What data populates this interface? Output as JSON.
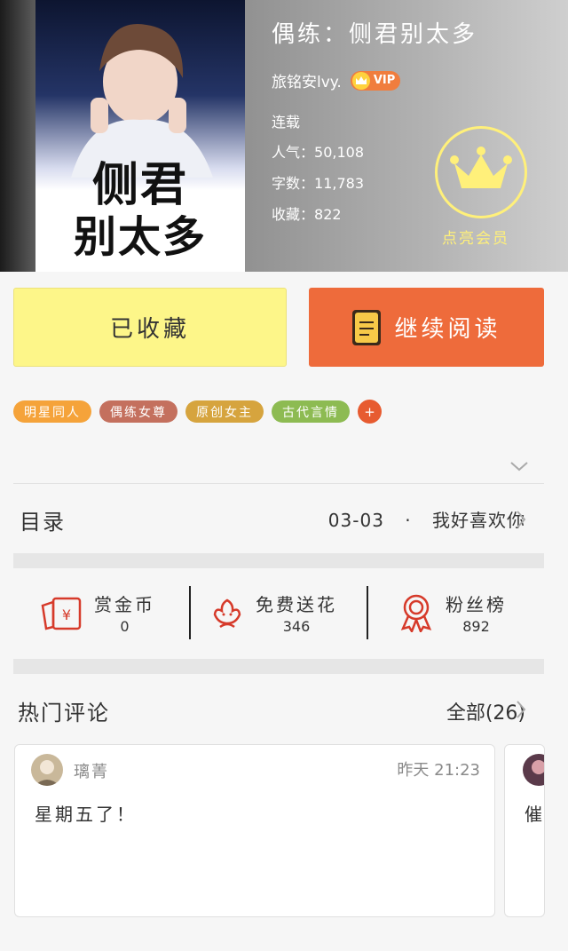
{
  "book": {
    "title": "偶练：侧君别太多",
    "cover_title_line1": "侧君",
    "cover_title_line2": "别太多",
    "author": "旅铭安lvy.",
    "vip_label": "VIP",
    "status": "连载",
    "popularity_label": "人气：",
    "popularity": "50,108",
    "word_count_label": "字数：",
    "word_count": "11,783",
    "favorites_label": "收藏：",
    "favorites": "822"
  },
  "member": {
    "label": "点亮会员",
    "icon": "crown-icon"
  },
  "actions": {
    "collected_label": "已收藏",
    "continue_label": "继续阅读"
  },
  "tags": [
    {
      "label": "明星同人",
      "color": "#f5a33a"
    },
    {
      "label": "偶练女尊",
      "color": "#c4705e"
    },
    {
      "label": "原创女主",
      "color": "#d6a43e"
    },
    {
      "label": "古代言情",
      "color": "#8dbb52"
    }
  ],
  "tag_add_label": "+",
  "catalog": {
    "label": "目录",
    "latest_date": "03-03",
    "separator": "·",
    "latest_title": "我好喜欢你"
  },
  "stats": [
    {
      "name": "赏金币",
      "value": "0",
      "icon": "red-envelope-icon"
    },
    {
      "name": "免费送花",
      "value": "346",
      "icon": "flower-icon"
    },
    {
      "name": "粉丝榜",
      "value": "892",
      "icon": "medal-icon"
    }
  ],
  "comments_section": {
    "title": "热门评论",
    "all_label": "全部(26)"
  },
  "comments": [
    {
      "user": "璃菁",
      "time": "昨天 21:23",
      "text": "星期五了！"
    },
    {
      "user": "",
      "time": "",
      "text": "催"
    }
  ],
  "colors": {
    "accent": "#ee6b3b",
    "collected_bg": "#fdf689",
    "member_yellow": "#fff07a"
  }
}
